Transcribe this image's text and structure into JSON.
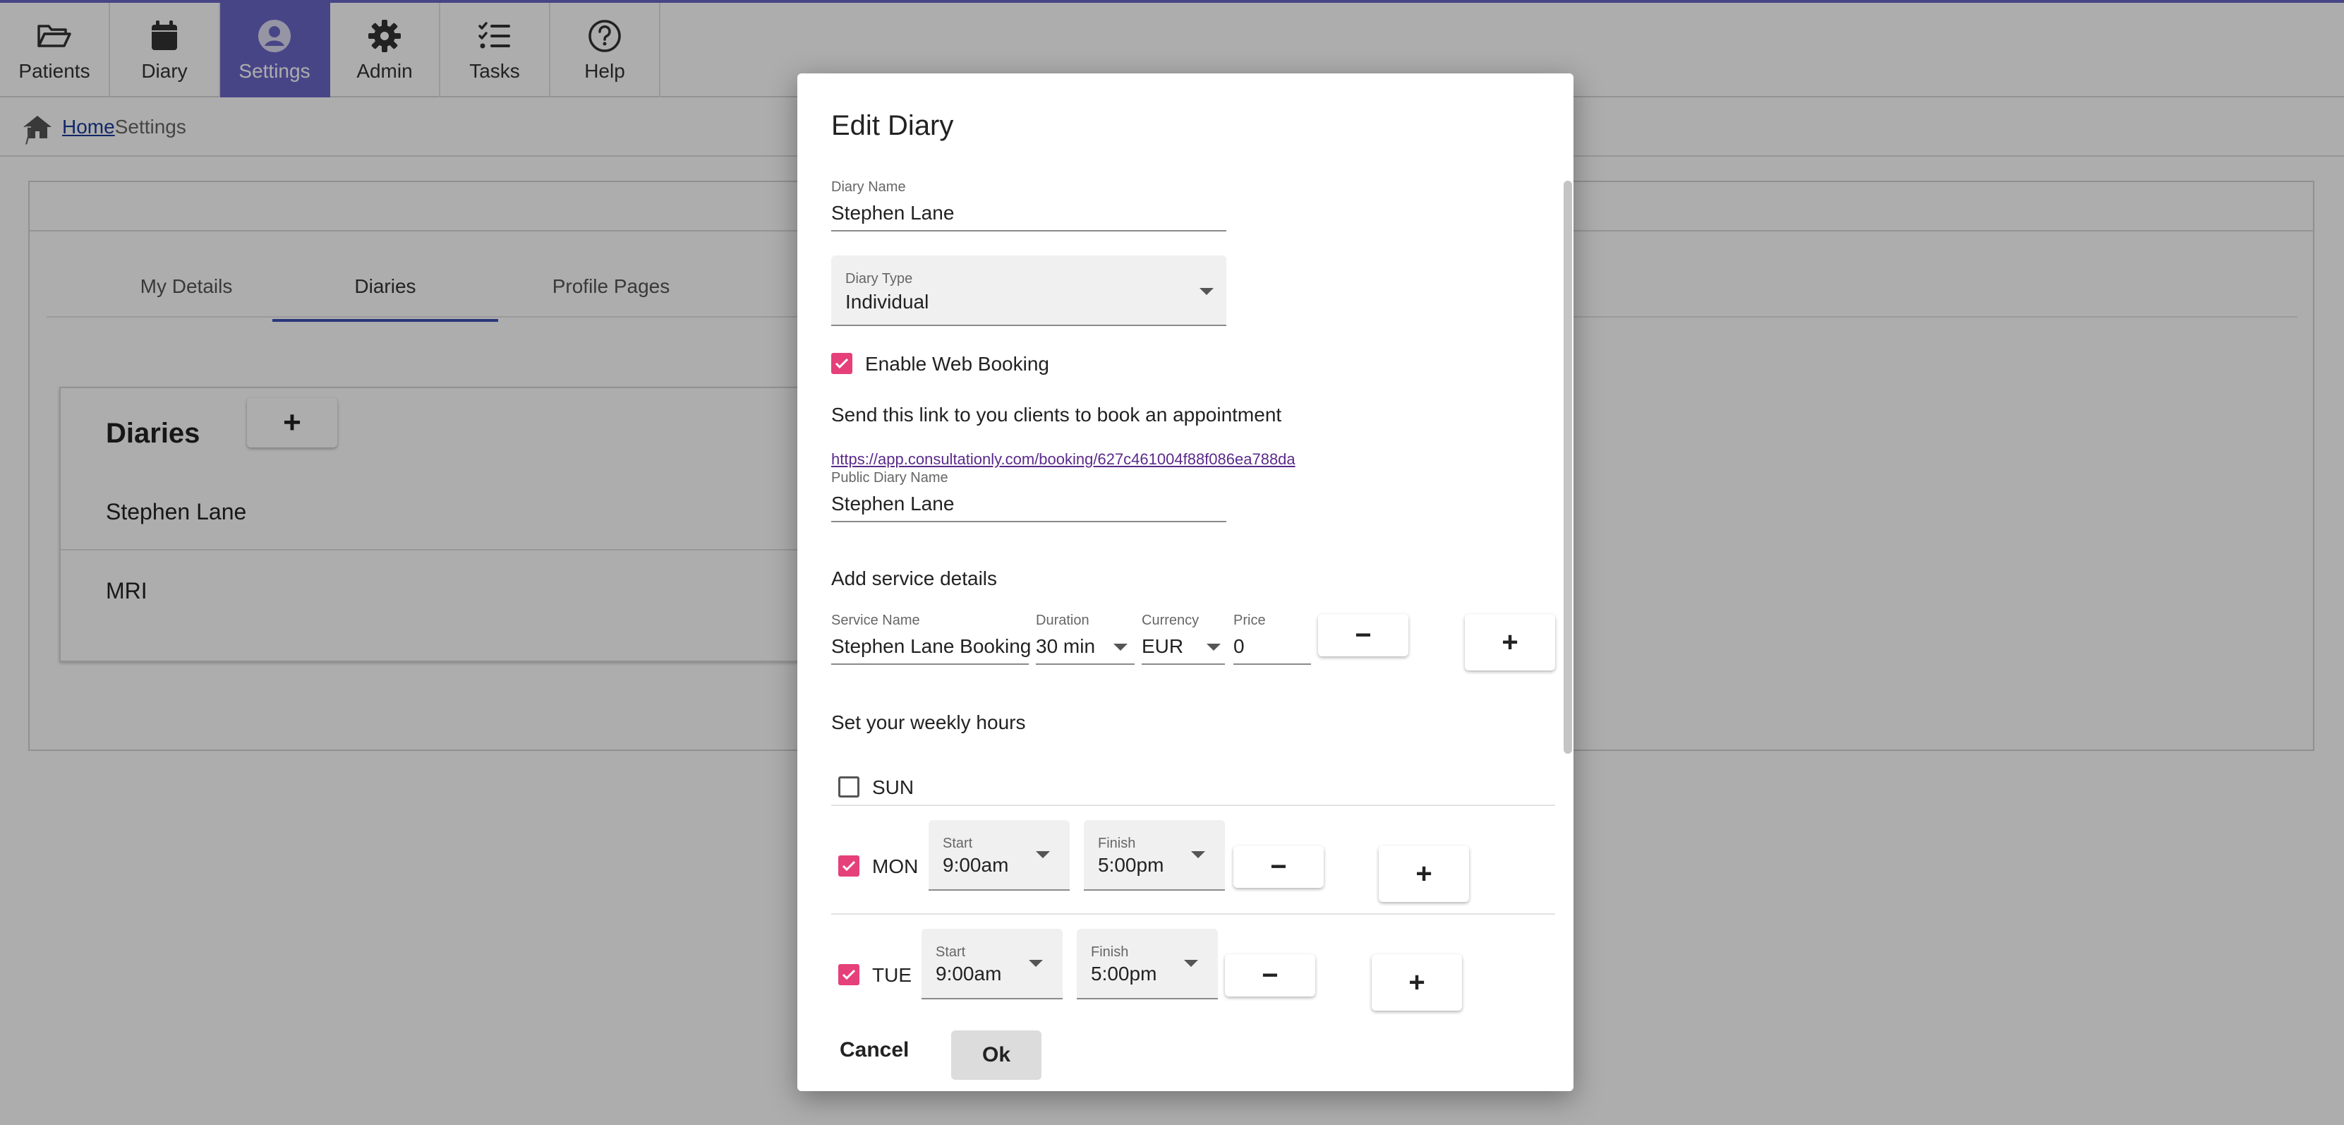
{
  "nav": {
    "items": [
      {
        "label": "Patients",
        "icon": "folder-open-icon"
      },
      {
        "label": "Diary",
        "icon": "calendar-icon"
      },
      {
        "label": "Settings",
        "icon": "user-circle-icon",
        "active": true
      },
      {
        "label": "Admin",
        "icon": "gear-icon"
      },
      {
        "label": "Tasks",
        "icon": "tasks-list-icon"
      },
      {
        "label": "Help",
        "icon": "question-circle-icon"
      }
    ],
    "accent_color": "#6a66c8"
  },
  "breadcrumb": {
    "home": "Home",
    "separator": "/",
    "current": "Settings"
  },
  "settings": {
    "tabs": [
      "My Details",
      "Diaries",
      "Profile Pages"
    ],
    "active_tab": "Diaries",
    "diaries": {
      "title": "Diaries",
      "add_label": "+",
      "items": [
        "Stephen Lane",
        "MRI"
      ]
    }
  },
  "dialog": {
    "title": "Edit Diary",
    "diary_name": {
      "label": "Diary Name",
      "value": "Stephen Lane"
    },
    "diary_type": {
      "label": "Diary Type",
      "value": "Individual"
    },
    "web_booking": {
      "label": "Enable Web Booking",
      "checked": true
    },
    "link_text": "Send this link to you clients to book an appointment",
    "booking_link": "https://app.consultationly.com/booking/627c461004f88f086ea788da",
    "public_name": {
      "label": "Public Diary Name",
      "value": "Stephen Lane"
    },
    "service_heading": "Add service details",
    "service": {
      "name": {
        "label": "Service Name",
        "value": "Stephen Lane Booking"
      },
      "duration": {
        "label": "Duration",
        "value": "30 min"
      },
      "currency": {
        "label": "Currency",
        "value": "EUR"
      },
      "price": {
        "label": "Price",
        "value": "0"
      },
      "remove_label": "−",
      "add_label": "+"
    },
    "hours_heading": "Set your weekly hours",
    "days": [
      {
        "day": "SUN",
        "checked": false
      },
      {
        "day": "MON",
        "checked": true,
        "start_label": "Start",
        "start": "9:00am",
        "finish_label": "Finish",
        "finish": "5:00pm"
      },
      {
        "day": "TUE",
        "checked": true,
        "start_label": "Start",
        "start": "9:00am",
        "finish_label": "Finish",
        "finish": "5:00pm"
      }
    ],
    "remove_label": "−",
    "add_label": "+",
    "cancel_label": "Cancel",
    "ok_label": "Ok",
    "checkbox_color": "#e5407a"
  }
}
